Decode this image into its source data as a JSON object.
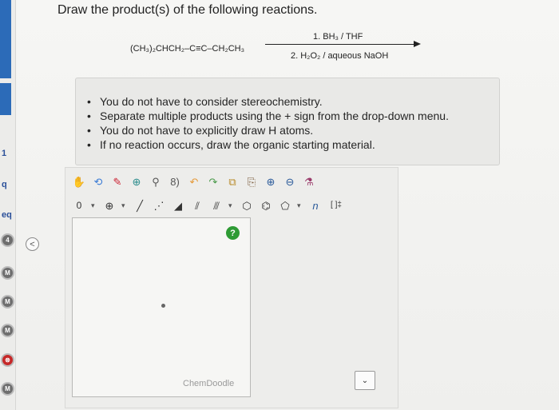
{
  "question": "Draw the product(s) of the following reactions.",
  "reaction": {
    "reactant": "(CH₃)₂CHCH₂–C≡C–CH₂CH₃",
    "reagent_1": "1. BH₃ / THF",
    "reagent_2": "2. H₂O₂ / aqueous NaOH"
  },
  "instructions": [
    "You do not have to consider stereochemistry.",
    "Separate multiple products using the + sign from the drop-down menu.",
    "You do not have to explicitly draw H atoms.",
    "If no reaction occurs, draw the organic starting material."
  ],
  "editor": {
    "watermark": "ChemDoodle",
    "help_label": "?",
    "charge_value": "0",
    "sgroup_label": "n",
    "bracket_label": "[ ]‡"
  },
  "sidebar": {
    "collapse_label": "<",
    "icons": [
      "1",
      "q",
      "eq",
      "4",
      "M",
      "M",
      "M",
      "⊗",
      "M"
    ]
  },
  "dropdown": {
    "value": ""
  },
  "colors": {
    "accent_blue": "#2c6bb8",
    "help_green": "#2e9b34",
    "error_red": "#c62828"
  }
}
